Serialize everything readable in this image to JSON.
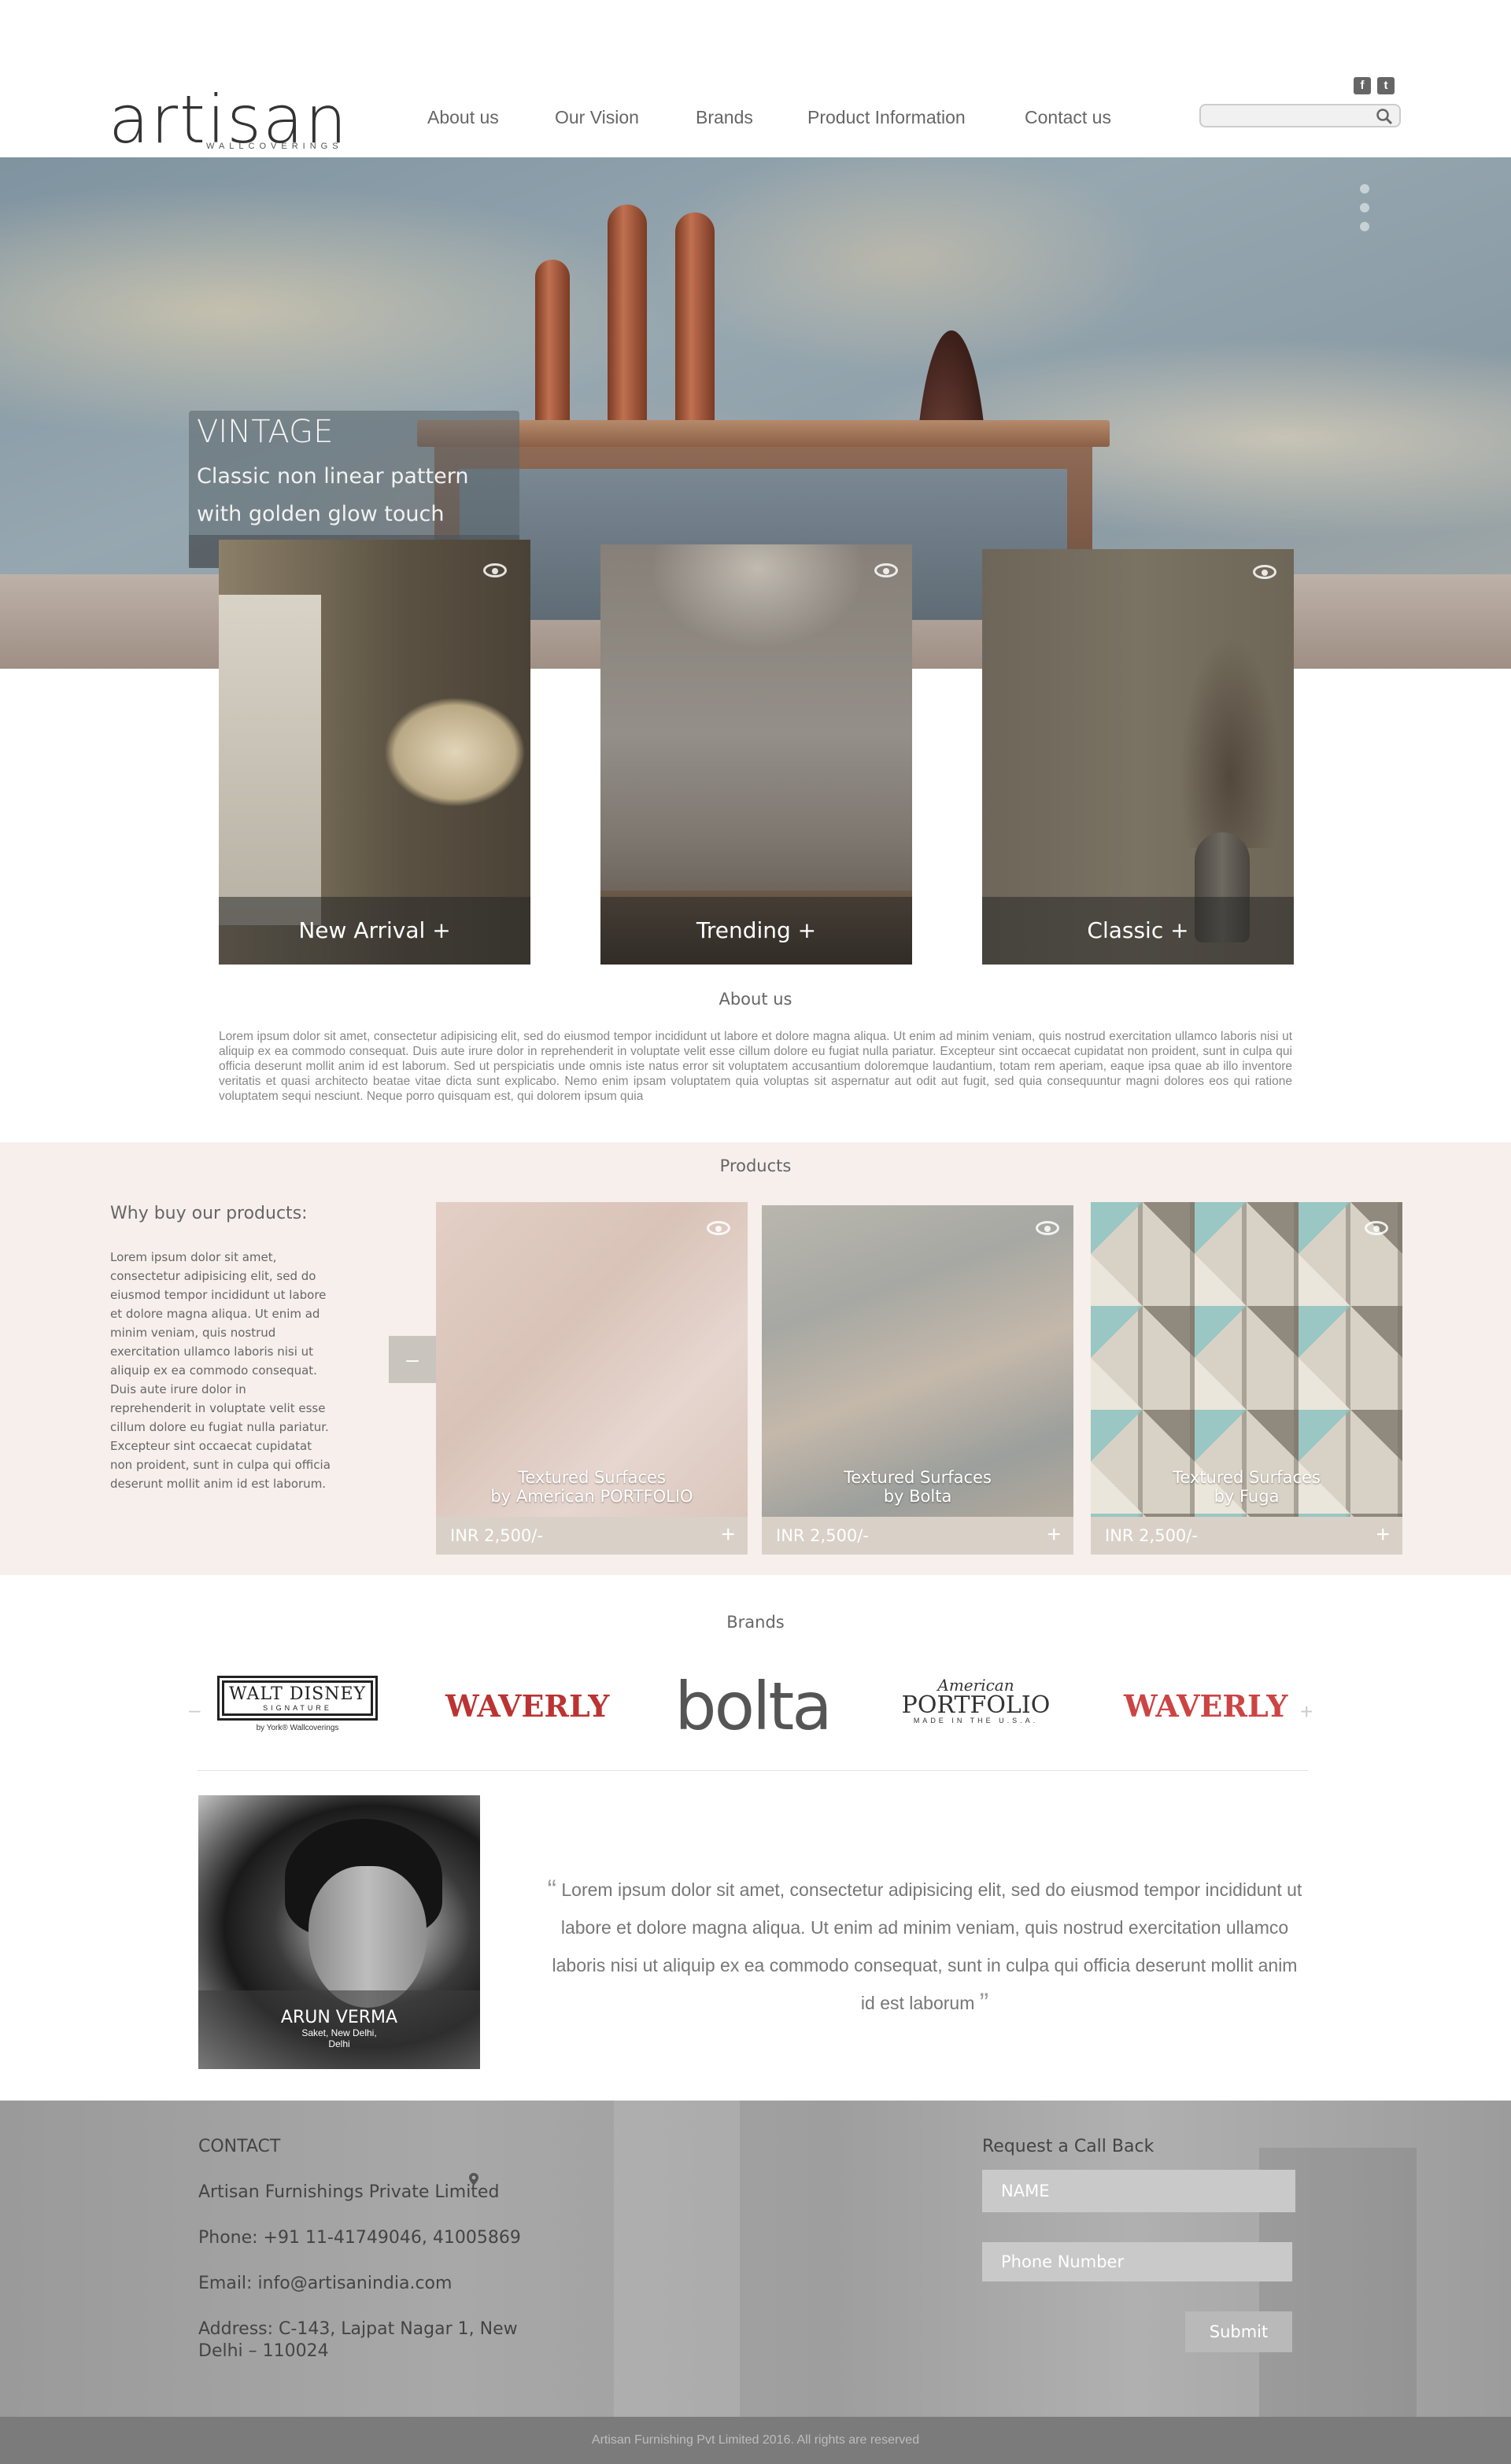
{
  "header": {
    "logo_text": "artisan",
    "logo_sub": "WALLCOVERINGS",
    "nav": [
      "About us",
      "Our Vision",
      "Brands",
      "Product Information",
      "Contact us"
    ],
    "social": [
      {
        "icon": "facebook-icon",
        "glyph": "f"
      },
      {
        "icon": "twitter-icon",
        "glyph": "t"
      }
    ],
    "search_placeholder": ""
  },
  "hero": {
    "title": "VINTAGE",
    "subtitle": "Classic non linear pattern with golden glow touch"
  },
  "categories": [
    {
      "label": "New Arrival +"
    },
    {
      "label": "Trending +"
    },
    {
      "label": "Classic +"
    }
  ],
  "about": {
    "title": "About us",
    "text": "Lorem ipsum dolor sit amet, consectetur adipisicing elit, sed do eiusmod tempor incididunt ut labore et dolore magna aliqua. Ut enim ad minim veniam, quis nostrud exercitation ullamco laboris nisi ut aliquip ex ea commodo consequat. Duis aute irure dolor in reprehenderit in voluptate velit esse cillum dolore eu fugiat nulla pariatur. Excepteur sint occaecat cupidatat non proident, sunt in culpa qui officia deserunt mollit anim id est laborum. Sed ut perspiciatis unde omnis iste natus error sit voluptatem accusantium doloremque laudantium, totam rem aperiam, eaque ipsa quae ab illo inventore veritatis et quasi architecto beatae vitae dicta sunt explicabo. Nemo enim ipsam voluptatem quia voluptas sit aspernatur aut odit aut fugit, sed quia consequuntur magni dolores eos qui ratione voluptatem sequi nesciunt. Neque porro quisquam est, qui dolorem ipsum quia"
  },
  "products": {
    "title": "Products",
    "why_title": "Why buy our products:",
    "why_text": "Lorem ipsum dolor sit amet, consectetur adipisicing elit, sed do eiusmod tempor incididunt ut labore et dolore magna aliqua. Ut enim ad minim veniam, quis nostrud exercitation ullamco laboris nisi ut aliquip ex ea commodo consequat. Duis aute irure dolor in reprehenderit in voluptate velit esse cillum dolore eu fugiat nulla pariatur. Excepteur sint occaecat cupidatat non proident, sunt in culpa qui officia deserunt mollit anim id est laborum.",
    "stepper": {
      "minus": "–",
      "plus": "+"
    },
    "items": [
      {
        "name_line1": "Textured Surfaces",
        "name_line2": "by American PORTFOLIO",
        "price": "INR 2,500/-"
      },
      {
        "name_line1": "Textured Surfaces",
        "name_line2": "by Bolta",
        "price": "INR 2,500/-"
      },
      {
        "name_line1": "Textured Surfaces",
        "name_line2": "by Fuga",
        "price": "INR 2,500/-"
      }
    ]
  },
  "brands": {
    "title": "Brands",
    "prev": "–",
    "next": "+",
    "disney_line1": "WALT DISNEY",
    "disney_line2": "SIGNATURE",
    "disney_sub": "by York® Wallcoverings",
    "waverly": "WAVERLY",
    "bolta": "bolta",
    "ap_script": "American",
    "ap_main": "PORTFOLIO",
    "ap_sub": "MADE IN THE U.S.A."
  },
  "testimonial": {
    "quote": "Lorem ipsum dolor sit amet, consectetur adipisicing elit, sed do eiusmod tempor incididunt ut labore et dolore magna aliqua. Ut enim ad minim veniam, quis nostrud exercitation ullamco laboris nisi ut aliquip ex ea commodo consequat, sunt in culpa qui officia deserunt mollit anim id est laborum",
    "open_quote": "“",
    "close_quote": "”",
    "name": "ARUN VERMA",
    "location1": "Saket, New Delhi,",
    "location2": "Delhi"
  },
  "footer": {
    "contact_title": "CONTACT",
    "company": "Artisan Furnishings Private Limited",
    "phone": "Phone: +91 11-41749046, 41005869",
    "email": "Email: info@artisanindia.com",
    "address1": "Address: C-143, Lajpat Nagar 1, New",
    "address2": "Delhi – 110024",
    "callback_title": "Request a Call Back",
    "name_placeholder": "NAME",
    "phone_placeholder": "Phone Number",
    "submit": "Submit",
    "copyright": "Artisan Furnishing Pvt Limited 2016. All rights are reserved"
  }
}
